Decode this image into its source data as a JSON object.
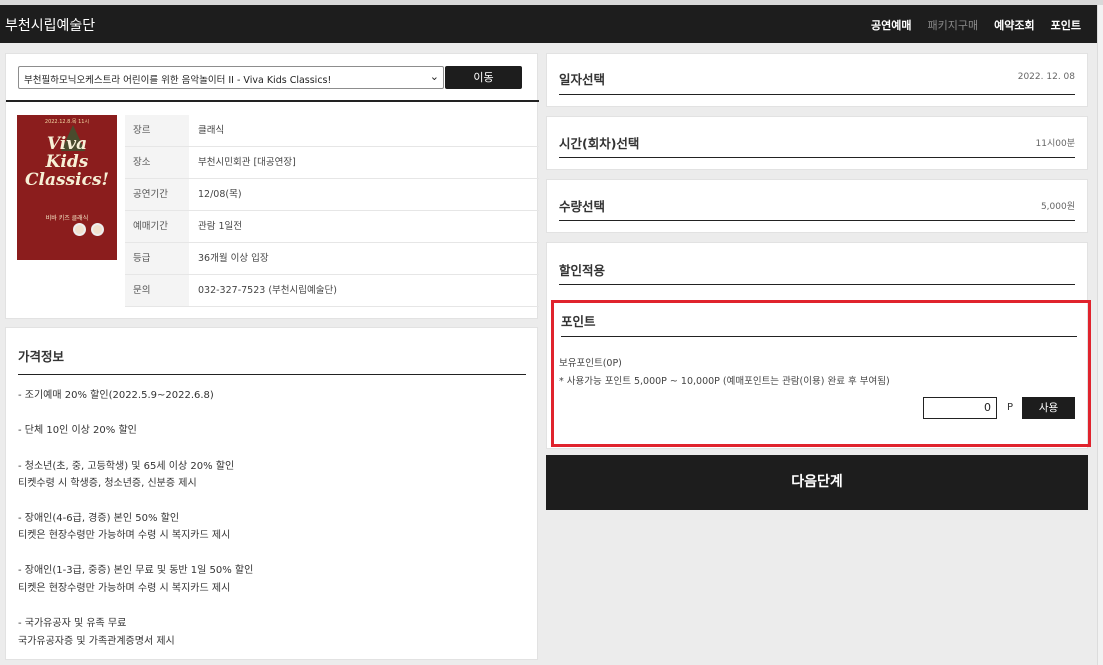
{
  "header": {
    "brand": "부천시립예술단",
    "nav": [
      {
        "label": "공연예매"
      },
      {
        "label": "패키지구매"
      },
      {
        "label": "예약조회"
      },
      {
        "label": "포인트"
      }
    ]
  },
  "show_select": {
    "selected": "부천필하모닉오케스트라 어린이를 위한 음악놀이터 II - Viva Kids Classics!",
    "button": "이동"
  },
  "poster": {
    "top_text": "2022.12.8.목 11시",
    "title_lines": [
      "Viva",
      "Kids",
      "Classics!"
    ],
    "subtitle": "비바 키즈 클래식"
  },
  "info": [
    {
      "label": "장르",
      "value": "클래식"
    },
    {
      "label": "장소",
      "value": "부천시민회관 [대공연장]"
    },
    {
      "label": "공연기간",
      "value": "12/08(목)"
    },
    {
      "label": "예매기간",
      "value": "관람 1일전"
    },
    {
      "label": "등급",
      "value": "36개월 이상 입장"
    },
    {
      "label": "문의",
      "value": "032-327-7523 (부천시립예술단)"
    }
  ],
  "price": {
    "title": "가격정보",
    "lines": [
      "- 조기예매 20% 할인(2022.5.9~2022.6.8)",
      "- 단체 10인 이상 20% 할인",
      "- 청소년(초, 중, 고등학생) 및 65세 이상 20% 할인",
      "티켓수령 시 학생증, 청소년증, 신분증 제시",
      "- 장애인(4-6급, 경증) 본인 50% 할인",
      "티켓은 현장수령만 가능하며 수령 시 복지카드 제시",
      "- 장애인(1-3급, 중증) 본인 무료 및 동반 1일 50% 할인",
      "티켓은 현장수령만 가능하며 수령 시 복지카드 제시",
      "- 국가유공자 및 유족 무료",
      "국가유공자증 및 가족관계증명서 제시"
    ]
  },
  "steps": {
    "date": {
      "title": "일자선택",
      "value": "2022. 12. 08"
    },
    "time": {
      "title": "시간(회차)선택",
      "value": "11시00분"
    },
    "qty": {
      "title": "수량선택",
      "value": "5,000원"
    },
    "discount": {
      "title": "할인적용"
    }
  },
  "point": {
    "title": "포인트",
    "owned": "보유포인트(0P)",
    "note": "* 사용가능 포인트 5,000P ~ 10,000P (예매포인트는 관람(이용) 완료 후 부여됨)",
    "input_value": "0",
    "unit": "P",
    "use_button": "사용"
  },
  "next_button": "다음단계",
  "colors": {
    "dark": "#1d1d1d",
    "highlight": "#e0232d"
  }
}
